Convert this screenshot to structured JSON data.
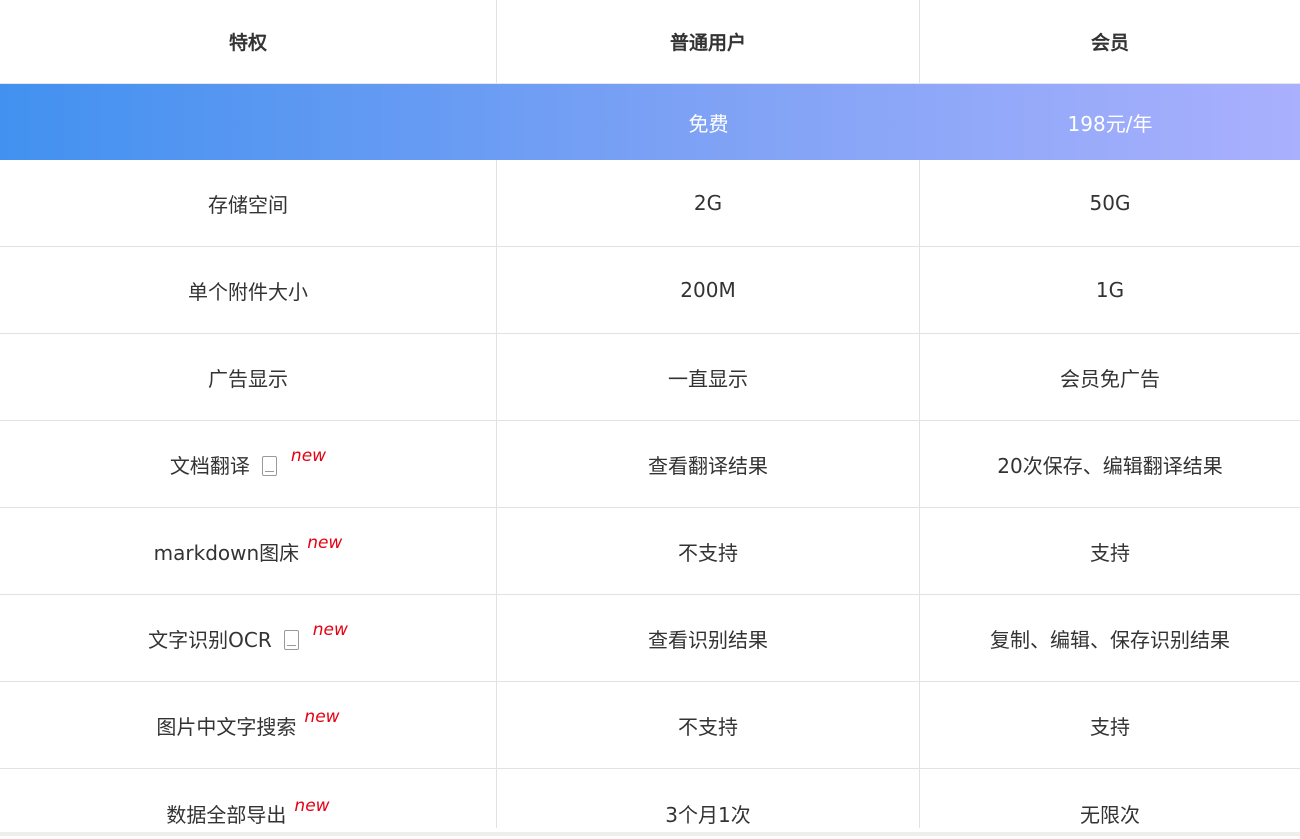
{
  "header": {
    "col1": "特权",
    "col2": "普通用户",
    "col3": "会员"
  },
  "price": {
    "col1": "",
    "col2": "免费",
    "col3": "198元/年"
  },
  "rows": [
    {
      "feature": "存储空间",
      "free": "2G",
      "member": "50G",
      "tablet_icon": false,
      "new": ""
    },
    {
      "feature": "单个附件大小",
      "free": "200M",
      "member": "1G",
      "tablet_icon": false,
      "new": ""
    },
    {
      "feature": "广告显示",
      "free": "一直显示",
      "member": "会员免广告",
      "tablet_icon": false,
      "new": ""
    },
    {
      "feature": "文档翻译",
      "free": "查看翻译结果",
      "member": "20次保存、编辑翻译结果",
      "tablet_icon": true,
      "new": "new"
    },
    {
      "feature": "markdown图床",
      "free": "不支持",
      "member": "支持",
      "tablet_icon": false,
      "new": "new"
    },
    {
      "feature": "文字识别OCR",
      "free": "查看识别结果",
      "member": "复制、编辑、保存识别结果",
      "tablet_icon": true,
      "new": "new"
    },
    {
      "feature": "图片中文字搜索",
      "free": "不支持",
      "member": "支持",
      "tablet_icon": false,
      "new": "new"
    },
    {
      "feature": "数据全部导出",
      "free": "3个月1次",
      "member": "无限次",
      "tablet_icon": false,
      "new": "new"
    }
  ],
  "icons": {
    "tablet": "tablet-icon"
  },
  "colors": {
    "gradient_start": "#4291f0",
    "gradient_end": "#a9b0fd",
    "new_badge": "#e60012"
  }
}
